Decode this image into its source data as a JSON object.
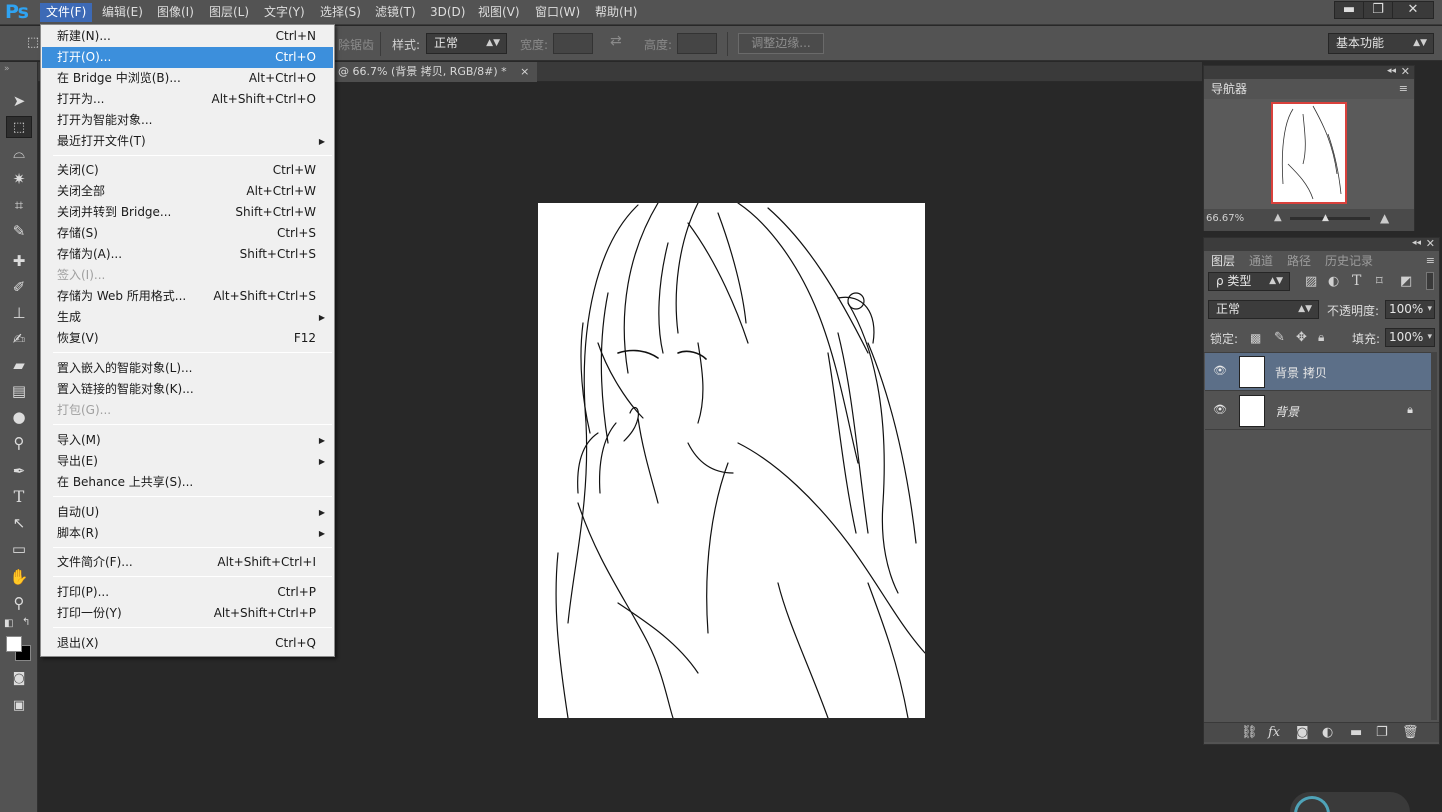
{
  "app": {
    "logo": "Ps"
  },
  "menubar": {
    "items": [
      "文件(F)",
      "编辑(E)",
      "图像(I)",
      "图层(L)",
      "文字(Y)",
      "选择(S)",
      "滤镜(T)",
      "3D(D)",
      "视图(V)",
      "窗口(W)",
      "帮助(H)"
    ],
    "active_index": 0
  },
  "window_controls": {
    "minimize": "▬",
    "restore": "❐",
    "close": "✕"
  },
  "options_bar": {
    "erase_residue": "除锯齿",
    "style_label": "样式:",
    "style_value": "正常",
    "width_label": "宽度:",
    "height_label": "高度:",
    "refine_edge": "调整边缘...",
    "workspace": "基本功能"
  },
  "document": {
    "tab_title": "@ 66.7% (背景 拷贝, RGB/8#) *",
    "tab_close": "×"
  },
  "file_menu": {
    "items": [
      {
        "label": "新建(N)...",
        "shortcut": "Ctrl+N"
      },
      {
        "label": "打开(O)...",
        "shortcut": "Ctrl+O",
        "highlight": true
      },
      {
        "label": "在 Bridge 中浏览(B)...",
        "shortcut": "Alt+Ctrl+O"
      },
      {
        "label": "打开为...",
        "shortcut": "Alt+Shift+Ctrl+O"
      },
      {
        "label": "打开为智能对象...",
        "shortcut": ""
      },
      {
        "label": "最近打开文件(T)",
        "shortcut": "",
        "submenu": true
      },
      {
        "label": "关闭(C)",
        "shortcut": "Ctrl+W"
      },
      {
        "label": "关闭全部",
        "shortcut": "Alt+Ctrl+W"
      },
      {
        "label": "关闭并转到 Bridge...",
        "shortcut": "Shift+Ctrl+W"
      },
      {
        "label": "存储(S)",
        "shortcut": "Ctrl+S"
      },
      {
        "label": "存储为(A)...",
        "shortcut": "Shift+Ctrl+S"
      },
      {
        "label": "签入(I)...",
        "shortcut": "",
        "disabled": true
      },
      {
        "label": "存储为 Web 所用格式...",
        "shortcut": "Alt+Shift+Ctrl+S"
      },
      {
        "label": "生成",
        "shortcut": "",
        "submenu": true
      },
      {
        "label": "恢复(V)",
        "shortcut": "F12"
      },
      {
        "label": "置入嵌入的智能对象(L)...",
        "shortcut": ""
      },
      {
        "label": "置入链接的智能对象(K)...",
        "shortcut": ""
      },
      {
        "label": "打包(G)...",
        "shortcut": "",
        "disabled": true
      },
      {
        "label": "导入(M)",
        "shortcut": "",
        "submenu": true
      },
      {
        "label": "导出(E)",
        "shortcut": "",
        "submenu": true
      },
      {
        "label": "在 Behance 上共享(S)...",
        "shortcut": ""
      },
      {
        "label": "自动(U)",
        "shortcut": "",
        "submenu": true
      },
      {
        "label": "脚本(R)",
        "shortcut": "",
        "submenu": true
      },
      {
        "label": "文件简介(F)...",
        "shortcut": "Alt+Shift+Ctrl+I"
      },
      {
        "label": "打印(P)...",
        "shortcut": "Ctrl+P"
      },
      {
        "label": "打印一份(Y)",
        "shortcut": "Alt+Shift+Ctrl+P"
      },
      {
        "label": "退出(X)",
        "shortcut": "Ctrl+Q"
      }
    ],
    "submenu_arrow": "▶"
  },
  "navigator": {
    "tab": "导航器",
    "zoom": "66.67%"
  },
  "layers_panel": {
    "tabs": [
      "图层",
      "通道",
      "路径",
      "历史记录"
    ],
    "filter_label": "ρ 类型",
    "blend_mode": "正常",
    "opacity_label": "不透明度:",
    "opacity_value": "100%",
    "lock_label": "锁定:",
    "fill_label": "填充:",
    "fill_value": "100%",
    "layers": [
      {
        "name": "背景 拷贝",
        "selected": true
      },
      {
        "name": "背景",
        "locked": true
      }
    ]
  },
  "colors": {
    "accent": "#3c8fdc",
    "ps_blue": "#2fa3f2",
    "panel": "#535353",
    "workspace": "#282828",
    "layer_selected": "#5c6f88"
  }
}
